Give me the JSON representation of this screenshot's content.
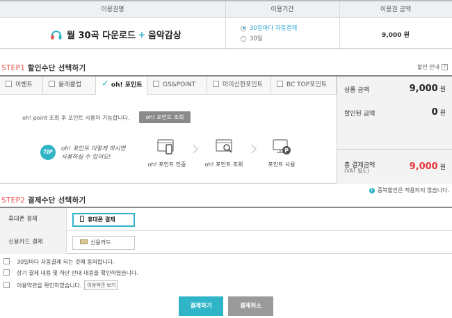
{
  "top_table": {
    "headers": [
      "이용권명",
      "이용기간",
      "이용권 금액"
    ],
    "product_name": "월 30곡 다운로드",
    "product_plus": "+",
    "product_extra": "음악감상",
    "period_options": [
      {
        "label": "30일마다 자동결제",
        "selected": true
      },
      {
        "label": "30일",
        "selected": false
      }
    ],
    "price": "9,000 원"
  },
  "step1": {
    "title_step": "STEP1",
    "title_text": "할인수단 선택하기",
    "help_label": "할인 안내",
    "help_icon": "?",
    "tabs": [
      {
        "label": "이벤트",
        "active": false
      },
      {
        "label": "올레클럽",
        "active": false
      },
      {
        "label": "oh! 포인트",
        "active": true
      },
      {
        "label": "GS&POINT",
        "active": false
      },
      {
        "label": "마이신한포인트",
        "active": false
      },
      {
        "label": "BC TOP포인트",
        "active": false
      }
    ],
    "point_note": "oh! point 조회 후 포인트 사용이 가능합니다.",
    "point_query_button": "oh! 포인트 조회",
    "tip_badge": "TIP",
    "tip_line1": "oh! 포인트 이렇게 하시면",
    "tip_line2": "사용하실 수 있어요!",
    "flow_steps": [
      "oh! 포인트 인증",
      "oh! 포인트 조회",
      "포인트 사용"
    ],
    "summary": {
      "product_label": "상품 금액",
      "product_value": "9,000",
      "discount_label": "할인된 금액",
      "discount_value": "0",
      "total_label": "총 결제금액",
      "total_note": "(VAT 별도)",
      "total_value": "9,000",
      "unit": "원"
    },
    "notice": "중복할인은 적용되지 않습니다."
  },
  "step2": {
    "title_step": "STEP2",
    "title_text": "결제수단 선택하기",
    "rows": [
      {
        "label": "휴대폰 결제",
        "option": "휴대폰 결제",
        "selected": true
      },
      {
        "label": "신용카드 결제",
        "option": "신용카드",
        "selected": false
      }
    ]
  },
  "agreements": [
    {
      "text": "30일마다 자동결제 되는 것에 동의합니다."
    },
    {
      "text": "상기 결제 내용 및 하단 안내 내용을 확인하였습니다."
    },
    {
      "text": "이용약관을 확인하였습니다.",
      "button": "이용약관 보기"
    }
  ],
  "actions": {
    "pay": "결제하기",
    "cancel": "결제취소"
  },
  "colors": {
    "accent": "#2fb4c8",
    "total_red": "#e8363c",
    "header_bg": "#eef1f4"
  }
}
